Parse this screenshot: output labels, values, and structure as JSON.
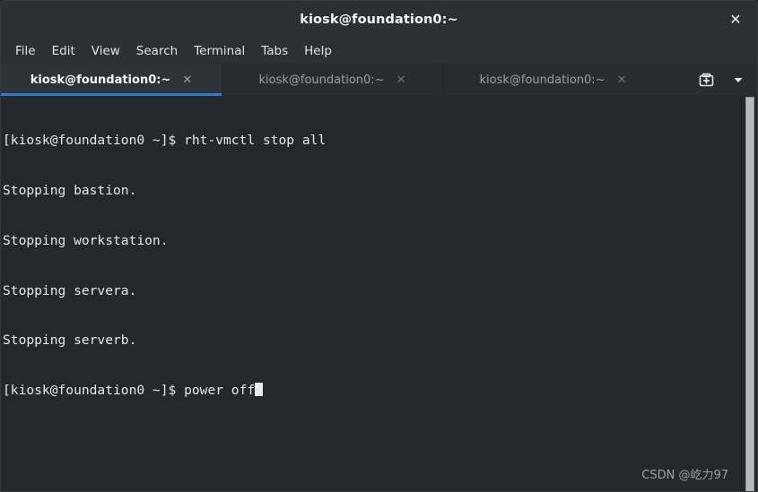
{
  "window": {
    "title": "kiosk@foundation0:~",
    "close_label": "✕"
  },
  "menubar": {
    "items": [
      {
        "label": "File"
      },
      {
        "label": "Edit"
      },
      {
        "label": "View"
      },
      {
        "label": "Search"
      },
      {
        "label": "Terminal"
      },
      {
        "label": "Tabs"
      },
      {
        "label": "Help"
      }
    ]
  },
  "tabbar": {
    "tabs": [
      {
        "label": "kiosk@foundation0:~",
        "close_label": "✕",
        "active": true
      },
      {
        "label": "kiosk@foundation0:~",
        "close_label": "✕",
        "active": false
      },
      {
        "label": "kiosk@foundation0:~",
        "close_label": "✕",
        "active": false
      }
    ],
    "new_tab_icon": "new-tab-icon",
    "tab_list_icon": "chevron-down-icon",
    "active_underline_color": "#2a7bd4"
  },
  "terminal": {
    "background_color": "#24282c",
    "foreground_color": "#e6e8ea",
    "lines": [
      "[kiosk@foundation0 ~]$ rht-vmctl stop all",
      "Stopping bastion.",
      "Stopping workstation.",
      "Stopping servera.",
      "Stopping serverb.",
      ""
    ],
    "prompt": "[kiosk@foundation0 ~]$ ",
    "current_command": "power off",
    "cursor": "block"
  },
  "scrollbar": {
    "orientation": "vertical",
    "thumb_color": "#b5babd"
  },
  "watermark": {
    "text": "CSDN @屹力97"
  }
}
